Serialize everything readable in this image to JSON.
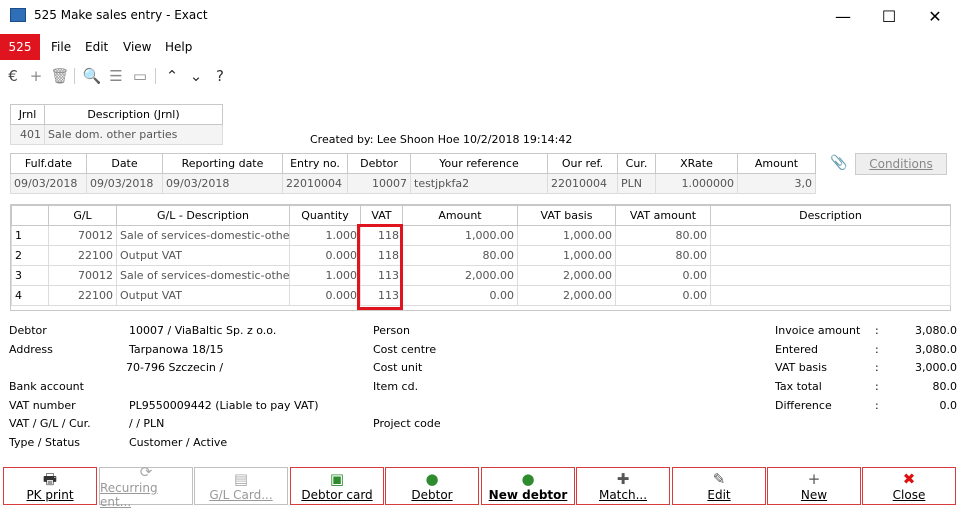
{
  "window": {
    "title": "525 Make sales entry - Exact",
    "minimize": "—",
    "maximize": "☐",
    "close": "✕"
  },
  "menu": {
    "badge": "525",
    "items": [
      "File",
      "Edit",
      "View",
      "Help"
    ]
  },
  "journal": {
    "headers": [
      "Jrnl",
      "Description (Jrnl)"
    ],
    "number": "401",
    "description": "Sale dom. other parties"
  },
  "created_by": "Created by: Lee Shoon Hoe  10/2/2018 19:14:42",
  "entry_header": {
    "columns": [
      "Fulf.date",
      "Date",
      "Reporting date",
      "Entry no.",
      "Debtor",
      "Your reference",
      "Our ref.",
      "Cur.",
      "XRate",
      "Amount"
    ],
    "values": [
      "09/03/2018",
      "09/03/2018",
      "09/03/2018",
      "22010004",
      "10007",
      "testjpkfa2",
      "22010004",
      "PLN",
      "1.000000",
      "3,0"
    ],
    "conditions_label": "Conditions"
  },
  "lines": {
    "columns": [
      "",
      "G/L",
      "G/L - Description",
      "Quantity",
      "VAT",
      "Amount",
      "VAT basis",
      "VAT amount",
      "Description"
    ],
    "rows": [
      [
        "1",
        "70012",
        "Sale of services-domestic-other",
        "1.000",
        "118",
        "1,000.00",
        "1,000.00",
        "80.00",
        ""
      ],
      [
        "2",
        "22100",
        "Output VAT",
        "0.000",
        "118",
        "80.00",
        "1,000.00",
        "80.00",
        ""
      ],
      [
        "3",
        "70012",
        "Sale of services-domestic-other",
        "1.000",
        "113",
        "2,000.00",
        "2,000.00",
        "0.00",
        ""
      ],
      [
        "4",
        "22100",
        "Output VAT",
        "0.000",
        "113",
        "0.00",
        "2,000.00",
        "0.00",
        ""
      ]
    ],
    "highlight_color": "#e0141e"
  },
  "details_left": {
    "labels": [
      "Debtor",
      "Address",
      "",
      "Bank account",
      "VAT number",
      "VAT / G/L / Cur.",
      "Type / Status"
    ],
    "values": [
      "10007 / ViaBaltic Sp. z o.o.",
      "Tarpanowa 18/15",
      "70-796 Szczecin /",
      "",
      "PL9550009442 (Liable to pay VAT)",
      "/   / PLN",
      "Customer / Active"
    ]
  },
  "details_mid": {
    "labels": [
      "Person",
      "Cost centre",
      "Cost unit",
      "Item cd.",
      "",
      "Project code"
    ]
  },
  "totals": {
    "labels": [
      "Invoice amount",
      "Entered",
      "VAT basis",
      "Tax total",
      "Difference"
    ],
    "values": [
      "3,080.0",
      "3,080.0",
      "3,000.0",
      "80.0",
      "0.0"
    ]
  },
  "buttons": [
    {
      "label": "PK print",
      "icon": "printer-icon",
      "glyph": "🖶"
    },
    {
      "label": "Recurring ent...",
      "icon": "recurring-icon",
      "glyph": "⟳"
    },
    {
      "label": "G/L Card...",
      "icon": "card-icon",
      "glyph": "▤"
    },
    {
      "label": "Debtor card",
      "icon": "contact-card-icon",
      "glyph": "▣"
    },
    {
      "label": "Debtor",
      "icon": "person-icon",
      "glyph": "●"
    },
    {
      "label": "New debtor",
      "icon": "new-person-icon",
      "glyph": "●"
    },
    {
      "label": "Match...",
      "icon": "puzzle-icon",
      "glyph": "✚"
    },
    {
      "label": "Edit",
      "icon": "pencil-icon",
      "glyph": "✎"
    },
    {
      "label": "New",
      "icon": "plus-icon",
      "glyph": "+"
    },
    {
      "label": "Close",
      "icon": "close-icon",
      "glyph": "✖"
    }
  ]
}
